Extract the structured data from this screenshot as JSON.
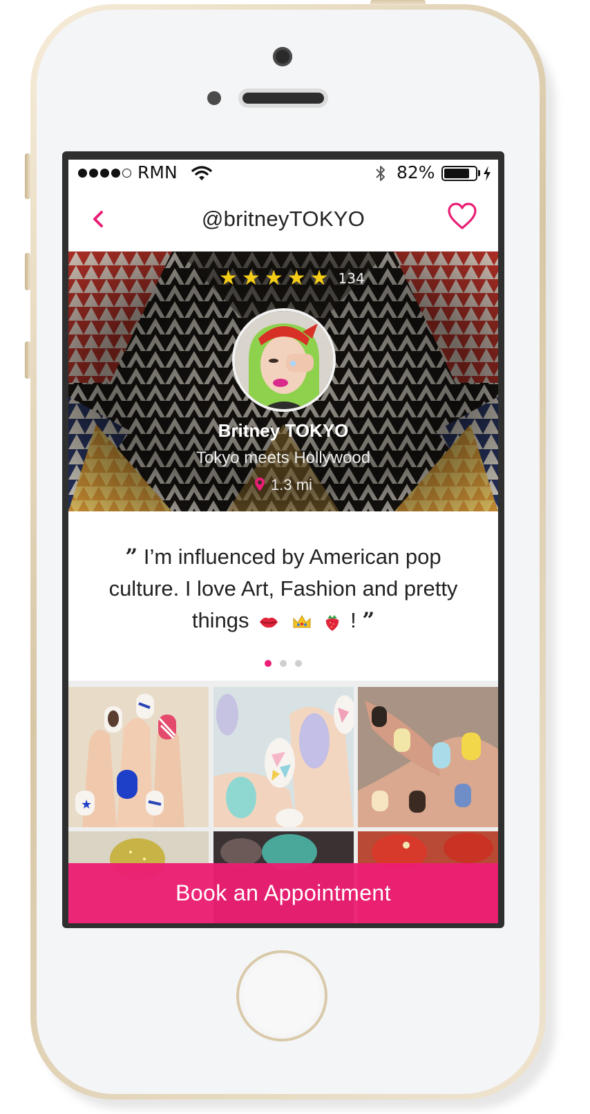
{
  "status_bar": {
    "carrier": "RMN",
    "battery_percent_label": "82%",
    "battery_level": 0.82
  },
  "nav": {
    "title": "@britneyTOKYO",
    "back_icon": "chevron-left-icon",
    "favorite_icon": "heart-outline-icon"
  },
  "profile": {
    "rating_stars": 5,
    "rating_count": "134",
    "name": "Britney TOKYO",
    "tagline": "Tokyo meets Hollywood",
    "distance": "1.3 mi"
  },
  "bio": {
    "open_quote": "”",
    "text": "I’m influenced by American pop culture. I love Art, Fashion and pretty things",
    "emojis": [
      "lips-emoji",
      "crown-emoji",
      "strawberry-emoji"
    ],
    "end_text": "!",
    "close_quote": "”"
  },
  "pager": {
    "pages": 3,
    "active": 0
  },
  "gallery": {
    "items": [
      "nail-photo-stars-stripes",
      "nail-photo-pastel-triangles",
      "nail-photo-character-art",
      "nail-photo-gold-glitter",
      "nail-photo-teal-glitter",
      "nail-photo-red-gems"
    ]
  },
  "cta": {
    "label": "Book an Appointment"
  },
  "colors": {
    "accent": "#E91E74",
    "star": "#F5CD17",
    "text": "#222222"
  }
}
